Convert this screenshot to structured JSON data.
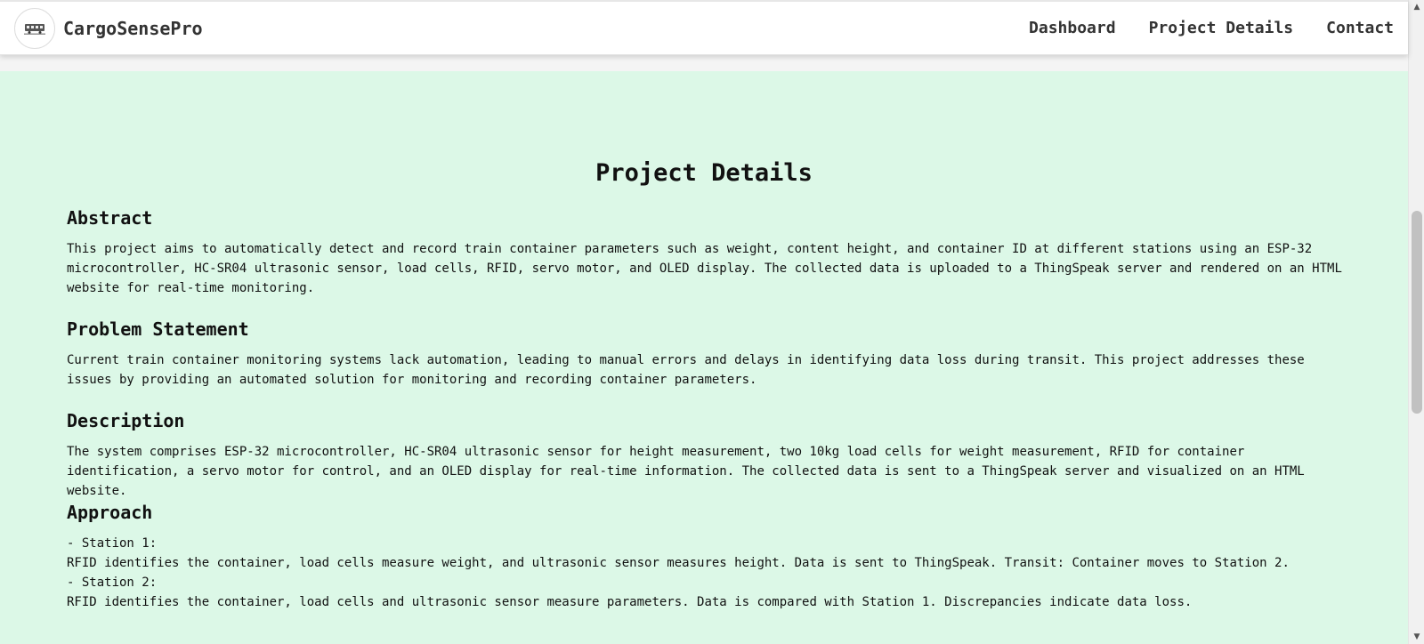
{
  "navbar": {
    "brand": "CargoSensePro",
    "logo_icon": "train-icon",
    "links": [
      {
        "label": "Dashboard"
      },
      {
        "label": "Project Details"
      },
      {
        "label": "Contact"
      }
    ]
  },
  "colors": {
    "content_background": "#dcf8e7",
    "navbar_background": "#ffffff",
    "text": "#111111"
  },
  "main": {
    "title": "Project Details",
    "sections": [
      {
        "heading": "Abstract",
        "text": "This project aims to automatically detect and record train container parameters such as weight, content height, and container ID at different stations using an ESP-32 microcontroller, HC-SR04 ultrasonic sensor, load cells, RFID, servo motor, and OLED display. The collected data is uploaded to a ThingSpeak server and rendered on an HTML website for real-time monitoring."
      },
      {
        "heading": "Problem Statement",
        "text": "Current train container monitoring systems lack automation, leading to manual errors and delays in identifying data loss during transit. This project addresses these issues by providing an automated solution for monitoring and recording container parameters."
      },
      {
        "heading": "Description",
        "text": "The system comprises ESP-32 microcontroller, HC-SR04 ultrasonic sensor for height measurement, two 10kg load cells for weight measurement, RFID for container identification, a servo motor for control, and an OLED display for real-time information. The collected data is sent to a ThingSpeak server and visualized on an HTML website."
      },
      {
        "heading": "Approach",
        "lines": [
          "- Station 1:",
          "RFID identifies the container, load cells measure weight, and ultrasonic sensor measures height. Data is sent to ThingSpeak. Transit: Container moves to Station 2.",
          "- Station 2:",
          "RFID identifies the container, load cells and ultrasonic sensor measure parameters. Data is compared with Station 1. Discrepancies indicate data loss."
        ]
      }
    ]
  },
  "scrollbar": {
    "up_icon": "scroll-up-arrow-icon",
    "down_icon": "scroll-down-arrow-icon"
  }
}
